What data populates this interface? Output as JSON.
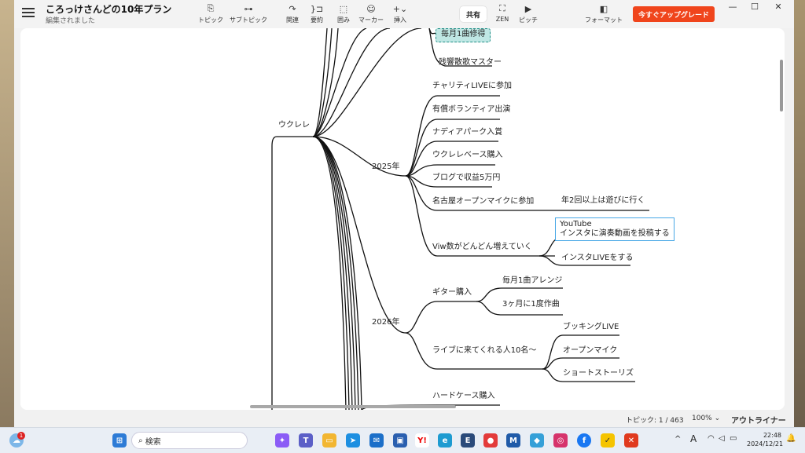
{
  "window": {
    "title": "ころっけさんどの10年プラン",
    "subtitle": "編集されました"
  },
  "toolbar": {
    "items": [
      {
        "label": "トピック",
        "icon": "topic-icon",
        "glyph": "⎘"
      },
      {
        "label": "サブトピック",
        "icon": "subtopic-icon",
        "glyph": "⊶"
      },
      {
        "label": "関連",
        "icon": "relation-icon",
        "glyph": "↷"
      },
      {
        "label": "要約",
        "icon": "summary-icon",
        "glyph": "}⊐"
      },
      {
        "label": "囲み",
        "icon": "boundary-icon",
        "glyph": "⬚"
      },
      {
        "label": "マーカー",
        "icon": "marker-icon",
        "glyph": "☺"
      },
      {
        "label": "挿入",
        "icon": "insert-icon",
        "glyph": "+⌄"
      },
      {
        "label": "ZEN",
        "icon": "zen-icon",
        "glyph": "⛶"
      },
      {
        "label": "ピッチ",
        "icon": "pitch-icon",
        "glyph": "▶"
      },
      {
        "label": "フォーマット",
        "icon": "format-icon",
        "glyph": "◧"
      }
    ],
    "share_label": "共有",
    "upgrade_label": "今すぐアップグレード"
  },
  "mindmap": {
    "root": "ウクレレ",
    "top_nodes": [
      "毎月1曲修得",
      "残響散歌マスター"
    ],
    "year_2025": {
      "label": "2025年",
      "children": [
        "チャリティLIVEに参加",
        "有償ボランティア出演",
        "ナディアパーク入賞",
        "ウクレレベース購入",
        "ブログで収益5万円",
        "名古屋オープンマイクに参加",
        "Viw数がどんどん増えていく"
      ],
      "openmic_child": "年2回以上は遊びに行く",
      "view_children": [
        "YouTube",
        "インスタに演奏動画を投稿する",
        "インスタLIVEをする"
      ]
    },
    "year_2026": {
      "label": "2026年",
      "guitar": "ギター購入",
      "guitar_children": [
        "毎月1曲アレンジ",
        "3ヶ月に1度作曲"
      ],
      "live": "ライブに来てくれる人10名〜",
      "live_children": [
        "ブッキングLIVE",
        "オープンマイク",
        "ショートストーリズ"
      ]
    },
    "bottom_node": "ハードケース購入"
  },
  "status": {
    "topic_count": "トピック: 1 / 463",
    "zoom": "100%",
    "mode": "アウトライナー"
  },
  "taskbar": {
    "search_placeholder": "検索",
    "time": "22:48",
    "date": "2024/12/21",
    "notification_count": "1"
  },
  "colors": {
    "upgrade": "#f0451c",
    "selected_fill": "#bfe7e4",
    "selected_border": "#1f8f86",
    "box_border": "#47a7e6"
  }
}
